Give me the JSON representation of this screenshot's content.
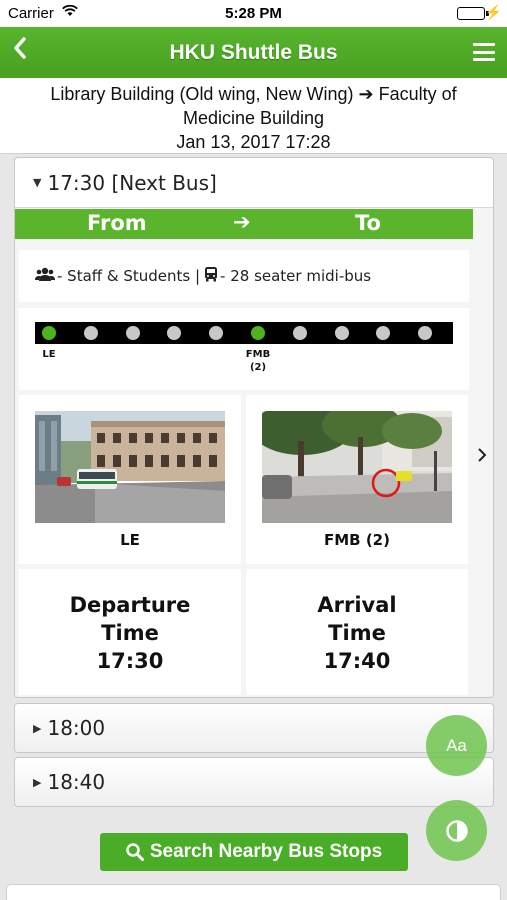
{
  "status_bar": {
    "carrier": "Carrier",
    "time": "5:28 PM"
  },
  "navbar": {
    "title": "HKU Shuttle Bus",
    "back_icon": "chevron-left-icon",
    "menu_icon": "hamburger-menu-icon"
  },
  "route": {
    "line1": "Library Building (Old wing, New Wing) ➔ Faculty of",
    "line2": "Medicine Building",
    "datetime": "Jan 13, 2017 17:28"
  },
  "trip_open": {
    "heading": "17:30 [Next Bus]",
    "from_label": "From",
    "to_label": "To",
    "passenger_info": "- Staff & Students |",
    "vehicle_info": "- 28 seater midi-bus",
    "stops": [
      {
        "label": "LE",
        "active": true
      },
      {
        "label": "",
        "active": false
      },
      {
        "label": "",
        "active": false
      },
      {
        "label": "",
        "active": false
      },
      {
        "label": "",
        "active": false
      },
      {
        "label": "FMB\n(2)",
        "active": true
      },
      {
        "label": "",
        "active": false
      },
      {
        "label": "",
        "active": false
      },
      {
        "label": "",
        "active": false
      },
      {
        "label": "",
        "active": false
      }
    ],
    "from_stop": {
      "caption": "LE"
    },
    "to_stop": {
      "caption": "FMB (2)"
    },
    "departure": {
      "line1": "Departure",
      "line2": "Time",
      "time": "17:30"
    },
    "arrival": {
      "line1": "Arrival",
      "line2": "Time",
      "time": "17:40"
    }
  },
  "trips_collapsed": [
    {
      "time": "18:00"
    },
    {
      "time": "18:40"
    }
  ],
  "search_button": {
    "label": "Search Nearby Bus Stops"
  },
  "fab": {
    "font_label": "Aa"
  },
  "colors": {
    "brand_green": "#4fae26",
    "active_stop": "#4cb51e"
  }
}
